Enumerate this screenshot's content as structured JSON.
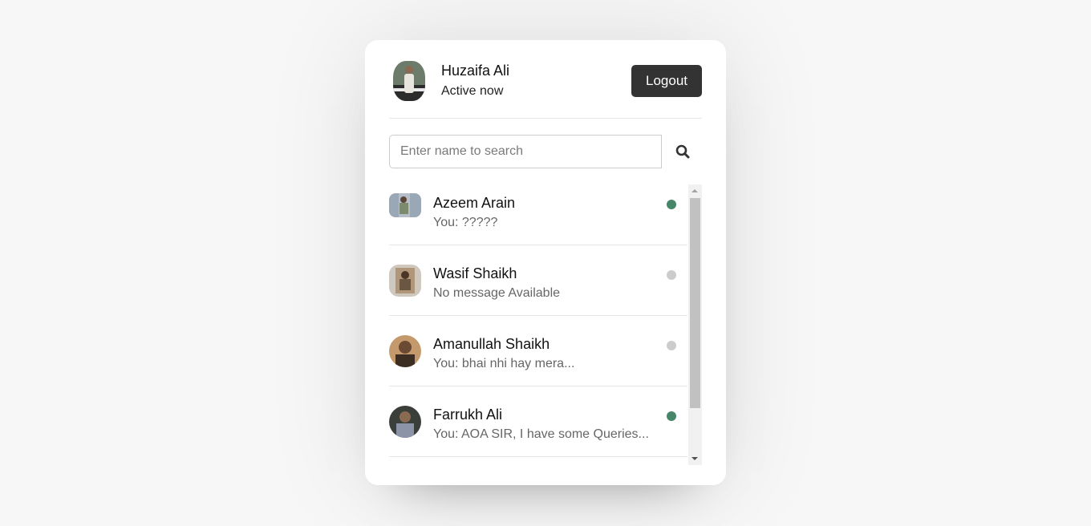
{
  "header": {
    "name": "Huzaifa Ali",
    "status": "Active now",
    "logout_label": "Logout"
  },
  "search": {
    "placeholder": "Enter name to search",
    "icon": "search-icon"
  },
  "users": [
    {
      "name": "Azeem Arain",
      "message": "You: ?????",
      "online": true
    },
    {
      "name": "Wasif Shaikh",
      "message": "No message Available",
      "online": false
    },
    {
      "name": "Amanullah Shaikh",
      "message": "You: bhai nhi hay mera...",
      "online": false
    },
    {
      "name": "Farrukh Ali",
      "message": "You: AOA SIR, I have some Queries...",
      "online": true
    }
  ],
  "colors": {
    "online": "#468669",
    "offline": "#cccccc",
    "button": "#333333"
  }
}
